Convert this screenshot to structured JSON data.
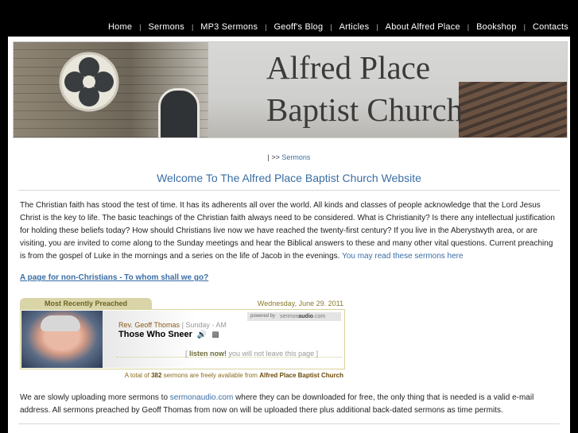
{
  "nav": {
    "items": [
      "Home",
      "Sermons",
      "MP3 Sermons",
      "Geoff's Blog",
      "Articles",
      "About Alfred Place",
      "Bookshop",
      "Contacts"
    ],
    "separator": "|"
  },
  "banner": {
    "title_line1": "Alfred Place",
    "title_line2": "Baptist Church"
  },
  "breadcrumb": {
    "prefix": "| >>",
    "link": "Sermons"
  },
  "welcome": "Welcome To The Alfred Place Baptist Church Website",
  "intro": {
    "text": "The Christian faith has stood the test of time. It has its adherents all over the world. All kinds and classes of people acknowledge that the Lord Jesus Christ is the key to life. The basic teachings of the Christian faith always need to be considered. What is Christianity? Is there any intellectual justification for holding these beliefs today? How should Christians live now we have reached the twenty-first century? If you live in the Aberystwyth area, or are visiting, you are invited to come along to the Sunday meetings and hear the Biblical answers to these and many other vital questions. Current preaching is from the gospel of Luke in the mornings and a series on the life of Jacob in the evenings.",
    "link": "You may read these sermons here"
  },
  "non_christians_link": "A page for non-Christians - To whom shall we go?",
  "sermon_widget": {
    "tab_label": "Most Recently Preached",
    "date": "Wednesday, June 29. 2011",
    "powered_by": "powered by",
    "powered_brand_a": "sermon",
    "powered_brand_b": "audio",
    "powered_brand_c": ".com",
    "speaker": "Rev. Geoff Thomas",
    "speaker_sub": "| Sunday - AM",
    "title": "Those Who Sneer",
    "listen_open": "[",
    "listen_label": "listen now!",
    "listen_note": "you will not leave this page",
    "listen_close": "]",
    "total_prefix": "A total of",
    "total_count": "382",
    "total_mid": "sermons are freely available from",
    "total_church": "Alfred Place Baptist Church"
  },
  "upload": {
    "before": "We are slowly uploading more sermons to",
    "link": "sermonaudio.com",
    "after": "where they can be downloaded for free, the only thing that is needed is a valid e-mail address. All sermons preached by Geoff Thomas from now on will be uploaded there plus additional back-dated sermons as time permits."
  },
  "colors": {
    "link": "#3a6ea5",
    "tab_bg": "#d9d5a8",
    "background": "#000000"
  }
}
